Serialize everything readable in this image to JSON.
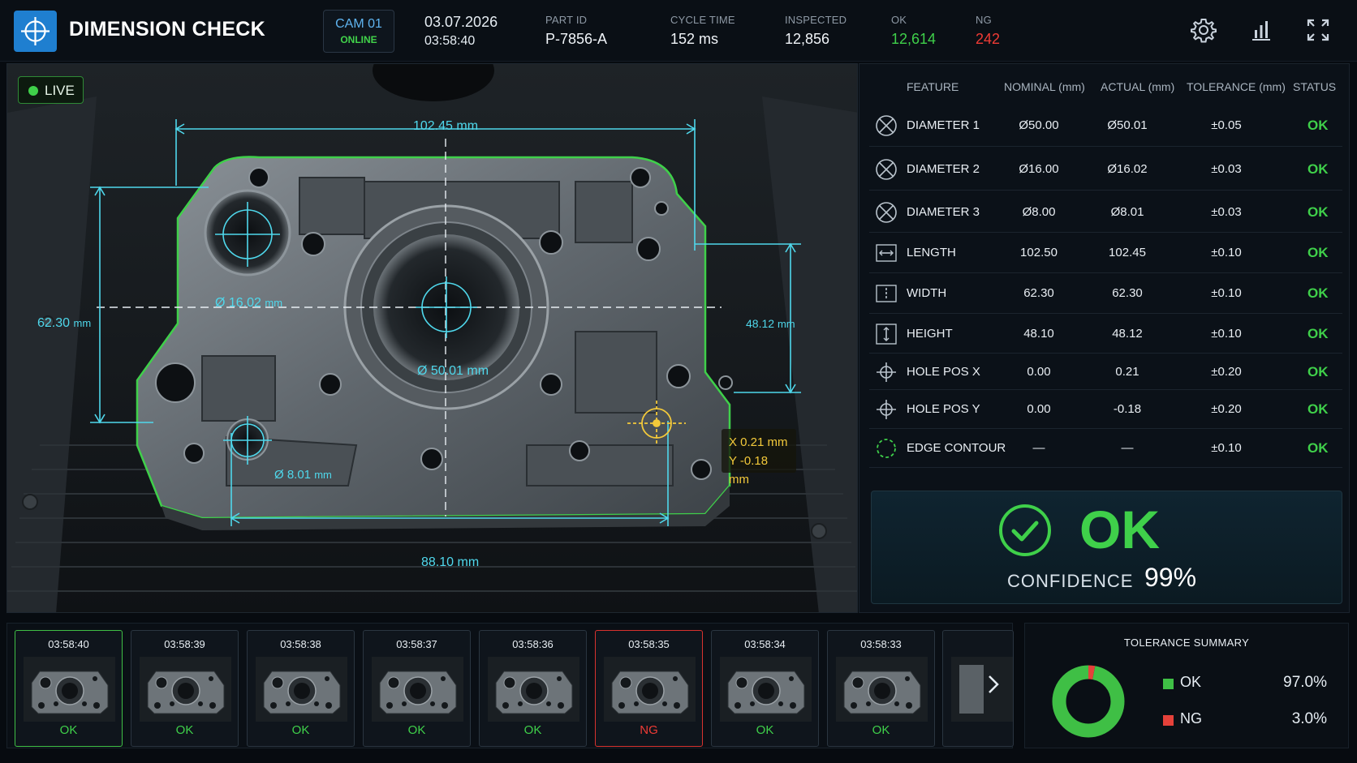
{
  "header": {
    "title": "DIMENSION CHECK",
    "camera": {
      "name": "CAM 01",
      "status": "ONLINE"
    },
    "date": "03.07.2026",
    "time": "03:58:40",
    "stats": [
      {
        "label": "PART ID",
        "value": "P-7856-A",
        "color": "#f0f4f8"
      },
      {
        "label": "CYCLE TIME",
        "value": "152 ms",
        "color": "#f0f4f8"
      },
      {
        "label": "INSPECTED",
        "value": "12,856",
        "color": "#f0f4f8"
      },
      {
        "label": "OK",
        "value": "12,614",
        "color": "#3fd04a"
      },
      {
        "label": "NG",
        "value": "242",
        "color": "#ef3b35"
      }
    ],
    "icons": [
      "gear-icon",
      "bar-chart-icon",
      "fullscreen-icon"
    ]
  },
  "camera_view": {
    "live_label": "LIVE",
    "dims": {
      "top_width": "102.45 mm",
      "left_height_num": "62.30",
      "left_height_unit": "mm",
      "right_height_num": "48.12",
      "right_height_unit": "mm",
      "bottom_width": "88.10 mm",
      "center_dia": "Ø 50.01 mm",
      "upper_left_dia_num": "Ø 16.02",
      "upper_left_dia_unit": "mm",
      "lower_left_dia_num": "Ø 8.01",
      "lower_left_dia_unit": "mm",
      "pos_x": "X  0.21 mm",
      "pos_y": "Y  -0.18 mm"
    }
  },
  "table": {
    "headers": {
      "feature": "FEATURE",
      "nominal": "NOMINAL (mm)",
      "actual": "ACTUAL (mm)",
      "tolerance": "TOLERANCE (mm)",
      "status": "STATUS"
    },
    "rows": [
      {
        "icon": "diameter-icon",
        "feature": "DIAMETER 1",
        "nominal": "Ø50.00",
        "actual": "Ø50.01",
        "tolerance": "±0.05",
        "status": "OK"
      },
      {
        "icon": "diameter-icon",
        "feature": "DIAMETER 2",
        "nominal": "Ø16.00",
        "actual": "Ø16.02",
        "tolerance": "±0.03",
        "status": "OK"
      },
      {
        "icon": "diameter-icon",
        "feature": "DIAMETER 3",
        "nominal": "Ø8.00",
        "actual": "Ø8.01",
        "tolerance": "±0.03",
        "status": "OK"
      },
      {
        "icon": "length-icon",
        "feature": "LENGTH",
        "nominal": "102.50",
        "actual": "102.45",
        "tolerance": "±0.10",
        "status": "OK"
      },
      {
        "icon": "width-icon",
        "feature": "WIDTH",
        "nominal": "62.30",
        "actual": "62.30",
        "tolerance": "±0.10",
        "status": "OK"
      },
      {
        "icon": "height-icon",
        "feature": "HEIGHT",
        "nominal": "48.10",
        "actual": "48.12",
        "tolerance": "±0.10",
        "status": "OK"
      },
      {
        "icon": "crosshair-icon",
        "feature": "HOLE POS X",
        "nominal": "0.00",
        "actual": "0.21",
        "tolerance": "±0.20",
        "status": "OK"
      },
      {
        "icon": "crosshair-icon",
        "feature": "HOLE POS Y",
        "nominal": "0.00",
        "actual": "-0.18",
        "tolerance": "±0.20",
        "status": "OK"
      },
      {
        "icon": "contour-icon",
        "feature": "EDGE CONTOUR",
        "nominal": "—",
        "actual": "—",
        "tolerance": "±0.10",
        "status": "OK"
      }
    ]
  },
  "result": {
    "status": "OK",
    "confidence_label": "CONFIDENCE",
    "confidence_value": "99%"
  },
  "history": [
    {
      "time": "03:58:40",
      "status": "OK",
      "selected": true
    },
    {
      "time": "03:58:39",
      "status": "OK"
    },
    {
      "time": "03:58:38",
      "status": "OK"
    },
    {
      "time": "03:58:37",
      "status": "OK"
    },
    {
      "time": "03:58:36",
      "status": "OK"
    },
    {
      "time": "03:58:35",
      "status": "NG"
    },
    {
      "time": "03:58:34",
      "status": "OK"
    },
    {
      "time": "03:58:33",
      "status": "OK"
    }
  ],
  "tolerance_summary": {
    "title": "TOLERANCE SUMMARY",
    "items": [
      {
        "label": "OK",
        "value": "97.0%",
        "fraction": 0.97,
        "color": "#3fbf45"
      },
      {
        "label": "NG",
        "value": "3.0%",
        "fraction": 0.03,
        "color": "#e5413a"
      }
    ]
  }
}
